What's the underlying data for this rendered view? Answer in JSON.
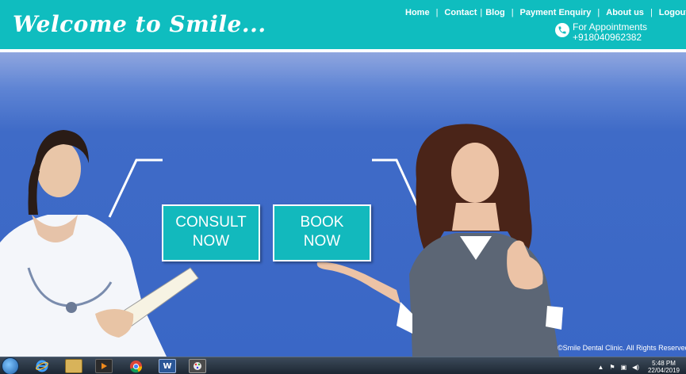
{
  "header": {
    "brand": "Welcome to Smile...",
    "nav": [
      {
        "label": "Home"
      },
      {
        "label": "Contact"
      },
      {
        "label": "Blog"
      },
      {
        "label": "Payment Enquiry"
      },
      {
        "label": "About us"
      },
      {
        "label": "Logout"
      }
    ],
    "appointment_label": "For Appointments",
    "appointment_phone": "+918040962382",
    "phone_icon": "phone-icon"
  },
  "hero": {
    "consult_line1": "CONSULT",
    "consult_line2": "NOW",
    "book_line1": "BOOK",
    "book_line2": "NOW",
    "copyright": "©Smile Dental Clinic. All Rights Reserved"
  },
  "taskbar": {
    "apps": [
      "start-orb-icon",
      "internet-explorer-icon",
      "file-explorer-icon",
      "media-player-icon",
      "chrome-icon",
      "word-icon",
      "paint-icon"
    ],
    "time": "5:48 PM",
    "date": "22/04/2019"
  },
  "colors": {
    "header_bg": "#0fbdbf",
    "hero_bg": "#3a67c6",
    "cta_bg": "#12b9bd"
  }
}
